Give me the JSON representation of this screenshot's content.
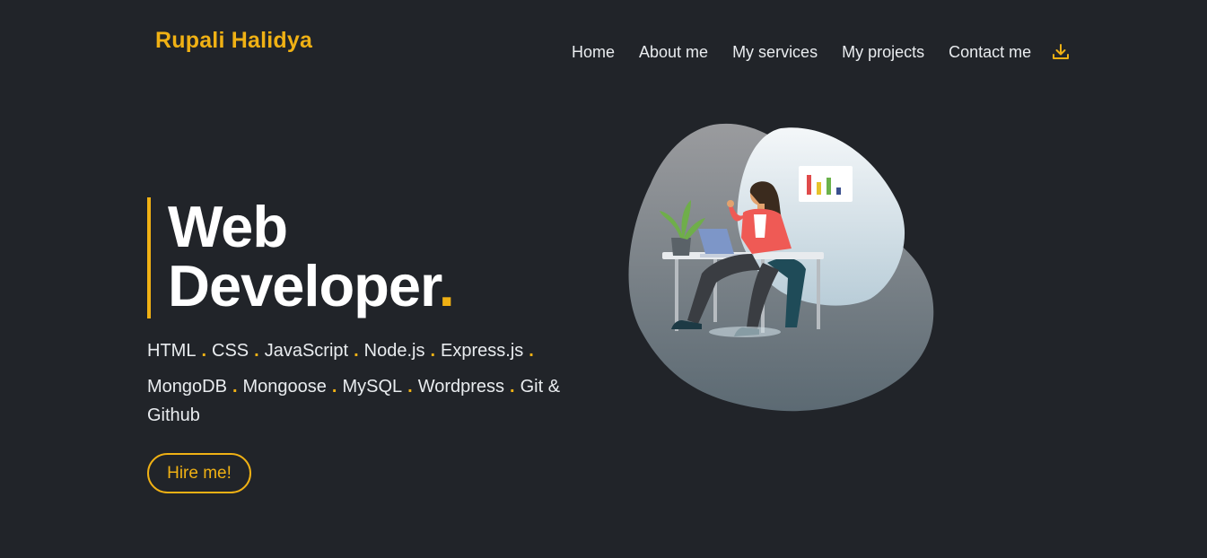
{
  "header": {
    "brand": "Rupali Halidya",
    "nav": [
      {
        "label": "Home"
      },
      {
        "label": "About me"
      },
      {
        "label": "My services"
      },
      {
        "label": "My projects"
      },
      {
        "label": "Contact me"
      }
    ],
    "download_icon": "download-icon"
  },
  "hero": {
    "title_line1": "Web",
    "title_line2": "Developer",
    "title_dot": ".",
    "skills_row1": [
      "HTML",
      "CSS",
      "JavaScript",
      "Node.js",
      "Express.js"
    ],
    "skills_row2": [
      "MongoDB",
      "Mongoose",
      "MySQL",
      "Wordpress",
      "Git & Github"
    ],
    "separator": ".",
    "hire_label": "Hire me!"
  },
  "colors": {
    "background": "#212429",
    "accent": "#f0b114",
    "text": "#e9ecef"
  }
}
